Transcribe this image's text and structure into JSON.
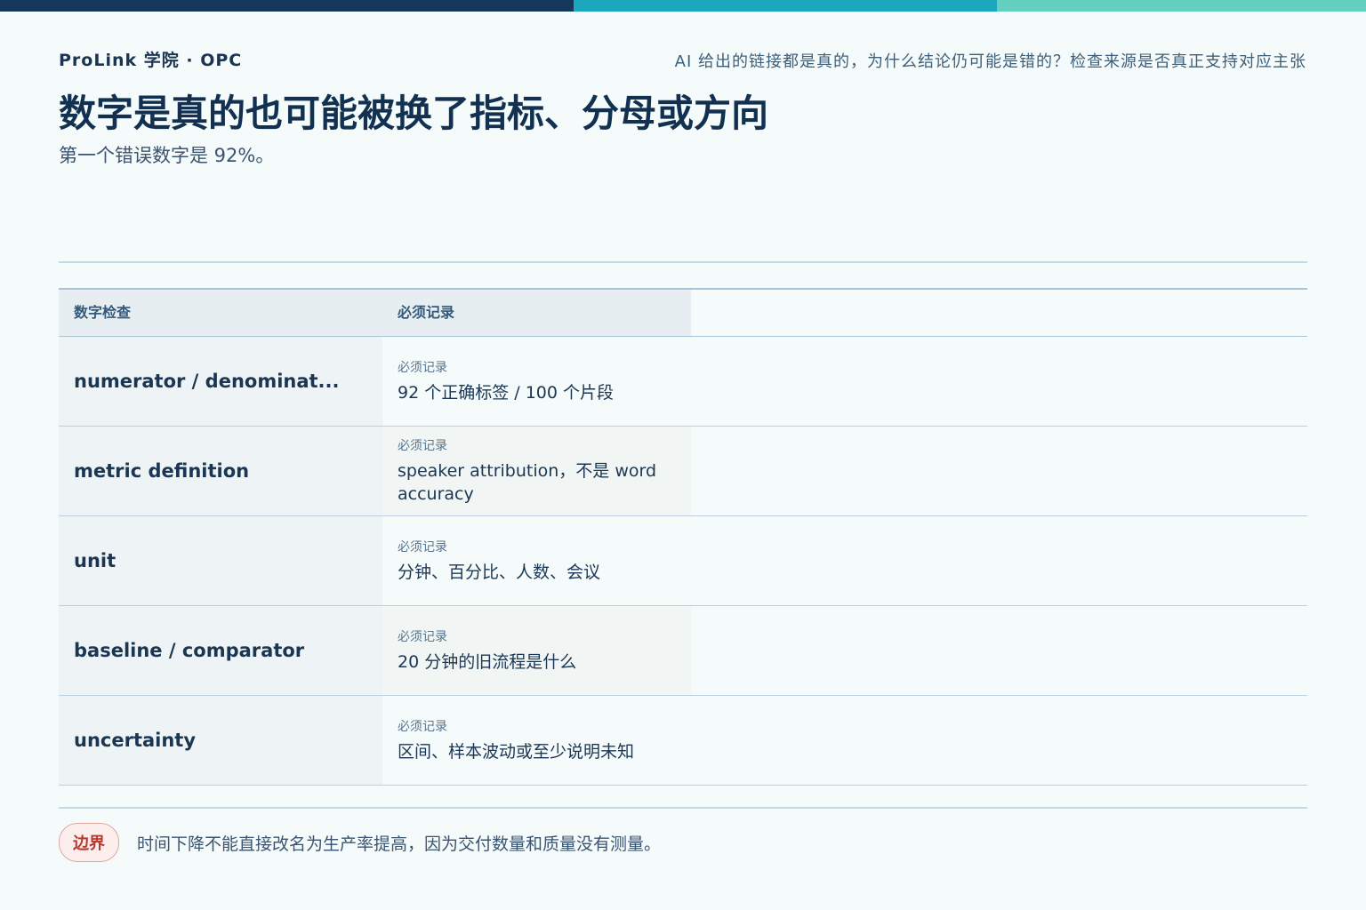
{
  "header": {
    "brand": "ProLink 学院 · OPC",
    "question": "AI 给出的链接都是真的，为什么结论仍可能是错的？检查来源是否真正支持对应主张",
    "title": "数字是真的也可能被换了指标、分母或方向",
    "subtitle": "第一个错误数字是 92%。"
  },
  "table": {
    "headers": [
      "数字检查",
      "必须记录"
    ],
    "rows": [
      {
        "check": "numerator / denominat...",
        "label": "必须记录",
        "value": "92 个正确标签 / 100 个片段"
      },
      {
        "check": "metric definition",
        "label": "必须记录",
        "value": "speaker attribution，不是 word accuracy"
      },
      {
        "check": "unit",
        "label": "必须记录",
        "value": "分钟、百分比、人数、会议"
      },
      {
        "check": "baseline / comparator",
        "label": "必须记录",
        "value": "20 分钟的旧流程是什么"
      },
      {
        "check": "uncertainty",
        "label": "必须记录",
        "value": "区间、样本波动或至少说明未知"
      }
    ]
  },
  "footer": {
    "badge": "边界",
    "text": "时间下降不能直接改名为生产率提高，因为交付数量和质量没有测量。"
  },
  "colors": {
    "bar_dark": "#14385c",
    "bar_teal": "#1ba7bd",
    "bar_mint": "#66d0c0",
    "badge_red": "#b83a2f"
  }
}
